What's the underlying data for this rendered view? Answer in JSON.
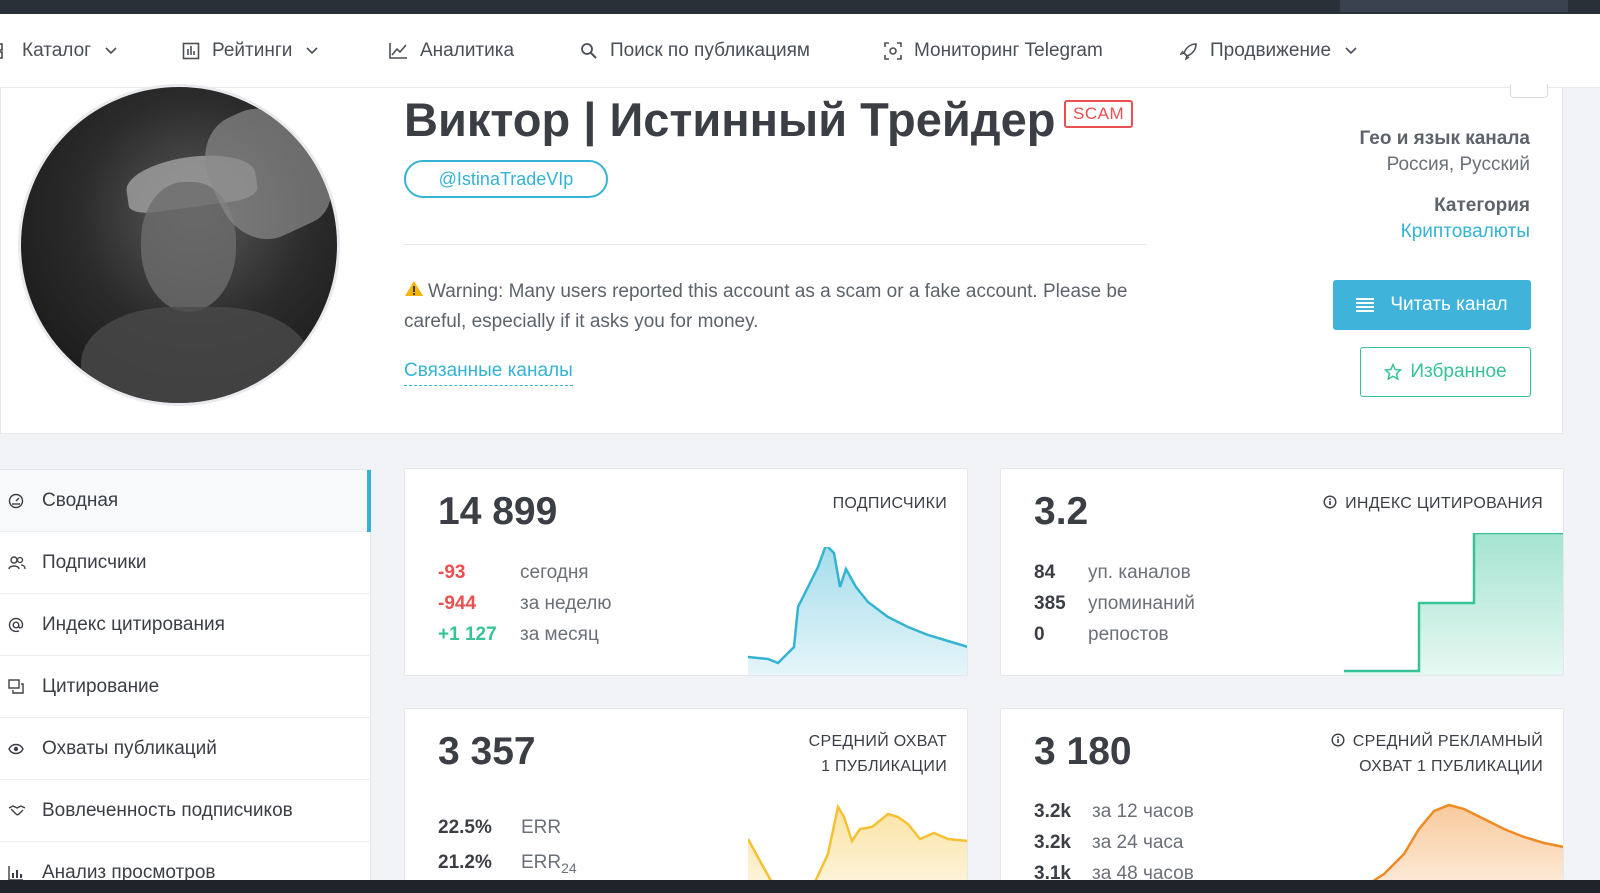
{
  "nav": {
    "items": [
      {
        "label": "Каталог",
        "icon": "grid-icon",
        "has_dropdown": true
      },
      {
        "label": "Рейтинги",
        "icon": "table-icon",
        "has_dropdown": true
      },
      {
        "label": "Аналитика",
        "icon": "line-chart-icon",
        "has_dropdown": false
      },
      {
        "label": "Поиск по публикациям",
        "icon": "search-icon",
        "has_dropdown": false
      },
      {
        "label": "Мониторинг Telegram",
        "icon": "scan-icon",
        "has_dropdown": false
      },
      {
        "label": "Продвижение",
        "icon": "rocket-icon",
        "has_dropdown": true
      }
    ]
  },
  "channel": {
    "title": "Виктор | Истинный Трейдер",
    "badge": "SCAM",
    "handle": "@IstinaTradeVIp",
    "warning": "Warning: Many users reported this account as a scam or a fake account. Please be careful, especially if it asks you for money.",
    "related_link": "Связанные каналы",
    "geo_label": "Гео и язык канала",
    "geo_value": "Россия, Русский",
    "category_label": "Категория",
    "category_value": "Криптовалюты",
    "read_button": "Читать канал",
    "favorite_button": "Избранное"
  },
  "sidebar": {
    "items": [
      {
        "label": "Сводная",
        "icon": "dashboard-icon",
        "active": true
      },
      {
        "label": "Подписчики",
        "icon": "users-icon",
        "active": false
      },
      {
        "label": "Индекс цитирования",
        "icon": "at-icon",
        "active": false
      },
      {
        "label": "Цитирование",
        "icon": "quote-icon",
        "active": false
      },
      {
        "label": "Охваты публикаций",
        "icon": "eye-icon",
        "active": false
      },
      {
        "label": "Вовлеченность подписчиков",
        "icon": "handshake-icon",
        "active": false
      },
      {
        "label": "Анализ просмотров",
        "icon": "bar-chart-icon",
        "active": false
      }
    ]
  },
  "cards": {
    "subscribers": {
      "value": "14 899",
      "label": "ПОДПИСЧИКИ",
      "rows": [
        {
          "value": "-93",
          "text": "сегодня",
          "tone": "negative"
        },
        {
          "value": "-944",
          "text": "за неделю",
          "tone": "negative"
        },
        {
          "value": "+1 127",
          "text": "за месяц",
          "tone": "positive"
        }
      ],
      "color": "#34b3d3"
    },
    "citation": {
      "value": "3.2",
      "label": "ИНДЕКС ЦИТИРОВАНИЯ",
      "rows": [
        {
          "value": "84",
          "text": "уп. каналов"
        },
        {
          "value": "385",
          "text": "упоминаний"
        },
        {
          "value": "0",
          "text": "репостов"
        }
      ],
      "color": "#37c297"
    },
    "reach": {
      "value": "3 357",
      "label_line1": "СРЕДНИЙ ОХВАТ",
      "label_line2": "1 ПУБЛИКАЦИИ",
      "rows": [
        {
          "value": "22.5%",
          "text": "ERR"
        },
        {
          "value": "21.2%",
          "text": "ERR",
          "sub": "24"
        }
      ],
      "color": "#f5c133"
    },
    "ad_reach": {
      "value": "3 180",
      "label_line1": "СРЕДНИЙ РЕКЛАМНЫЙ",
      "label_line2": "ОХВАТ 1 ПУБЛИКАЦИИ",
      "rows": [
        {
          "value": "3.2k",
          "text": "за 12 часов"
        },
        {
          "value": "3.2k",
          "text": "за 24 часа"
        },
        {
          "value": "3.1k",
          "text": "за 48 часов"
        }
      ],
      "color": "#f08a24"
    }
  }
}
